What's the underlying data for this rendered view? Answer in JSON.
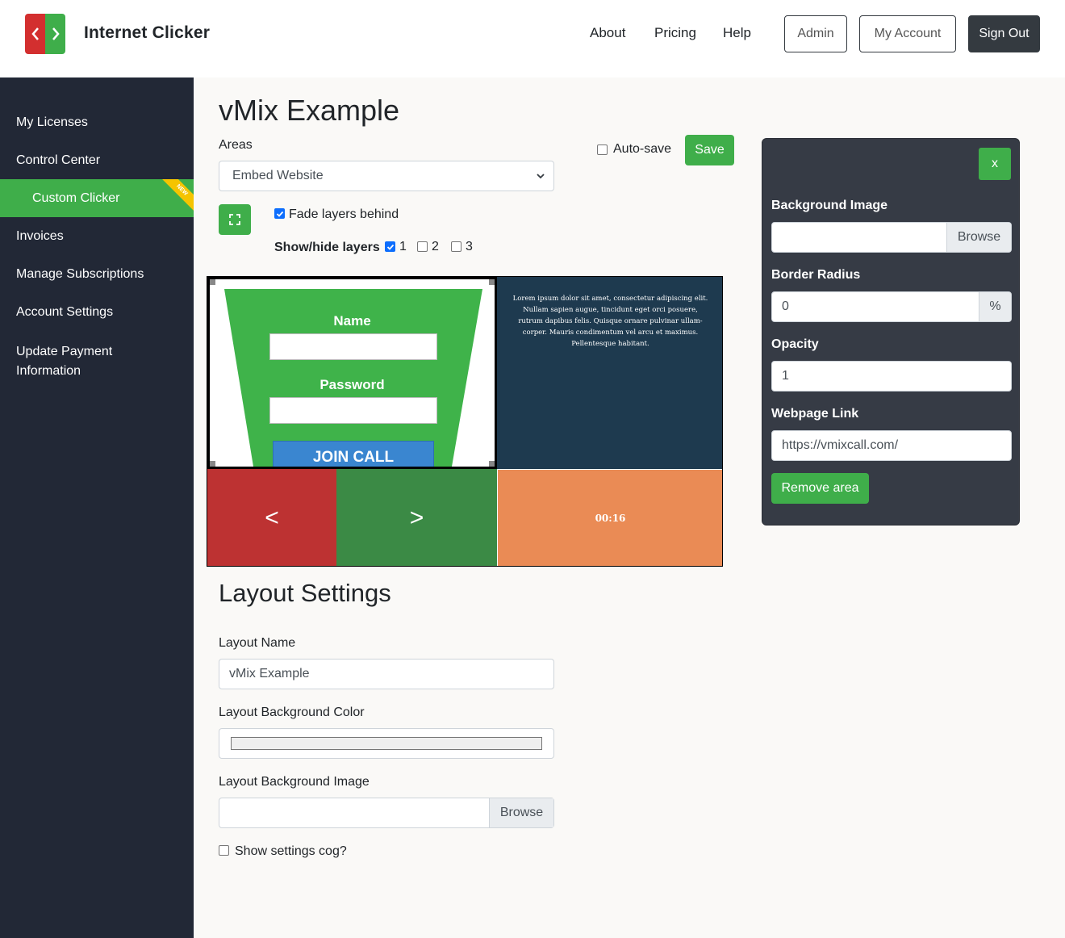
{
  "header": {
    "brand": "Internet Clicker",
    "nav": [
      "About",
      "Pricing",
      "Help"
    ],
    "buttons": {
      "admin": "Admin",
      "my_account": "My Account",
      "sign_out": "Sign Out"
    }
  },
  "sidebar": {
    "items": [
      {
        "label": "My Licenses"
      },
      {
        "label": "Control Center"
      },
      {
        "label": "Custom Clicker",
        "active": true,
        "badge": "NEW"
      },
      {
        "label": "Invoices"
      },
      {
        "label": "Manage Subscriptions"
      },
      {
        "label": "Account Settings"
      },
      {
        "label": "Update Payment Information"
      }
    ]
  },
  "editor": {
    "title": "vMix Example",
    "areas_label": "Areas",
    "areas_selected": "Embed Website",
    "autosave_label": "Auto-save",
    "autosave_checked": false,
    "save_label": "Save",
    "fade_label": "Fade layers behind",
    "fade_checked": true,
    "showhide_label": "Show/hide layers",
    "layers": [
      {
        "label": "1",
        "checked": true
      },
      {
        "label": "2",
        "checked": false
      },
      {
        "label": "3",
        "checked": false
      }
    ]
  },
  "preview": {
    "embed": {
      "name_label": "Name",
      "password_label": "Password",
      "join_label": "JOIN CALL"
    },
    "text_area": "Lorem ipsum dolor sit amet, consectetur adipiscing elit. Nullam sapien augue, tincidunt eget orci posuere, rutrum dapibus felis. Quisque ornare pulvinar ullam-corper. Mauris condimentum vel arcu et maximus. Pellentesque habitant.",
    "prev_label": "<",
    "next_label": ">",
    "timer": "00:16",
    "colors": {
      "embed_bg": "#3fb34a",
      "text_bg": "#1e3a4f",
      "prev_bg": "#bd3232",
      "next_bg": "#3b8a45",
      "timer_bg": "#ea8b55"
    }
  },
  "layout_settings": {
    "title": "Layout Settings",
    "name_label": "Layout Name",
    "name_value": "vMix Example",
    "bg_color_label": "Layout Background Color",
    "bg_image_label": "Layout Background Image",
    "browse_label": "Browse",
    "cog_label": "Show settings cog?",
    "cog_checked": false
  },
  "area_panel": {
    "close_label": "x",
    "bg_image_label": "Background Image",
    "browse_label": "Browse",
    "radius_label": "Border Radius",
    "radius_value": "0",
    "radius_unit": "%",
    "opacity_label": "Opacity",
    "opacity_value": "1",
    "link_label": "Webpage Link",
    "link_value": "https://vmixcall.com/",
    "remove_label": "Remove area"
  },
  "theme": {
    "accent": "#3fae4a",
    "sidebar_bg": "#222836",
    "panel_bg": "#363b45",
    "dark_button": "#343a40"
  }
}
